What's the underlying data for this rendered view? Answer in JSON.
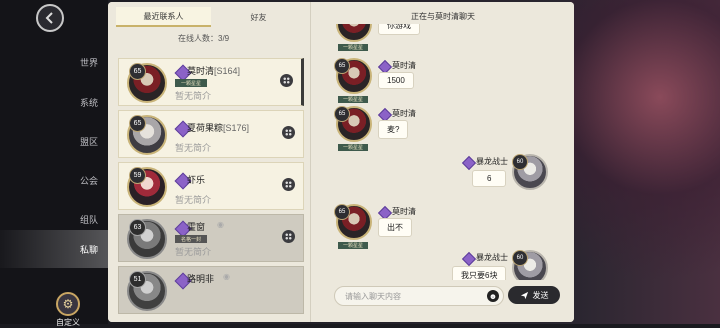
{
  "sidebar": {
    "items": [
      {
        "label": "世界"
      },
      {
        "label": "系统"
      },
      {
        "label": "盟区"
      },
      {
        "label": "公会"
      },
      {
        "label": "组队"
      },
      {
        "label": "私聊"
      }
    ],
    "active_index": 5,
    "custom_label": "自定义"
  },
  "contacts_panel": {
    "tabs": [
      {
        "label": "最近联系人"
      },
      {
        "label": "好友"
      }
    ],
    "online_text": "在线人数：",
    "online_count": "3/9",
    "contacts": [
      {
        "level": "65",
        "name": "莫时清",
        "server": "[S164]",
        "badge": "一颗星星",
        "bio": "暂无简介"
      },
      {
        "level": "65",
        "name": "夏荷果粽",
        "server": "[S176]",
        "badge": "",
        "bio": "暂无简介"
      },
      {
        "level": "59",
        "name": "虾乐",
        "server": "",
        "badge": "",
        "bio": "暂无简介"
      },
      {
        "level": "63",
        "name": "霍窗",
        "server": "",
        "badge": "名格一封",
        "bio": "暂无简介"
      },
      {
        "level": "51",
        "name": "路明非",
        "server": "",
        "badge": "",
        "bio": "暂无简介"
      }
    ]
  },
  "chat": {
    "title": "正在与莫时清聊天",
    "messages": [
      {
        "side": "left",
        "level": "65",
        "name": "",
        "tag": "一颗星星",
        "text": "你游戏"
      },
      {
        "side": "left",
        "level": "65",
        "name": "莫时清",
        "tag": "一颗星星",
        "text": "1500"
      },
      {
        "side": "left",
        "level": "65",
        "name": "莫时清",
        "tag": "一颗星星",
        "text": "麦?"
      },
      {
        "side": "right",
        "level": "60",
        "name": "暴龙战士",
        "tag": "",
        "text": "6"
      },
      {
        "side": "left",
        "level": "65",
        "name": "莫时清",
        "tag": "一颗星星",
        "text": "出不"
      },
      {
        "side": "right",
        "level": "60",
        "name": "暴龙战士",
        "tag": "",
        "text": "我只要6块"
      }
    ],
    "input_placeholder": "请输入聊天内容",
    "send_label": "发送"
  },
  "colors": {
    "accent_gold": "#c9b479",
    "vip_purple": "#8b62c7",
    "tag_green": "#3e5a4c"
  }
}
